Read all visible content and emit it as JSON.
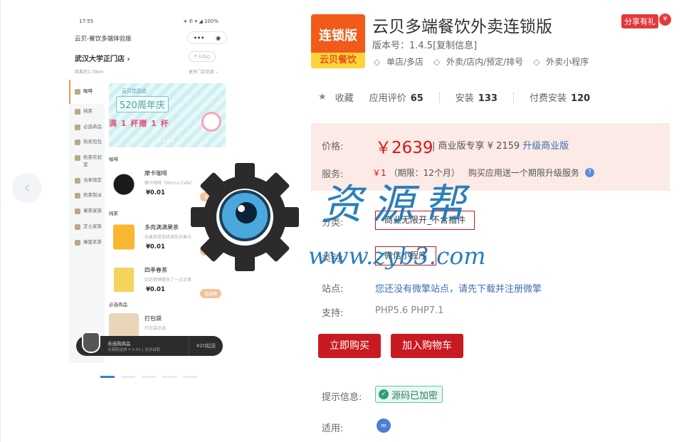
{
  "gallery": {
    "prev_icon": "chevron-left-icon",
    "phone": {
      "time": "17:55",
      "signal": "∗ ✆ ▾ ◢ 100%",
      "title": "云贝-餐饮多端体验版",
      "capsule_more": "•••",
      "capsule_close": "◉",
      "store": "武汉大学正门店 ›",
      "center": "个人中心",
      "distance": "距离您1.79km",
      "more_stores": "更多门店信息 ⌄",
      "side_items": [
        "咖啡",
        "纯茶",
        "必选商品",
        "热卖包包",
        "奶茶实验室",
        "当季限定",
        "奶茶制冰",
        "果茶家族",
        "芝士家族",
        "蜂蜜茗茶"
      ],
      "banner_top": "云贝饮品店",
      "banner_main": "520周年庆",
      "banner_sub": "满 1 杯赠 1 杯",
      "categories": [
        "咖啡",
        "纯茶",
        "必选商品"
      ],
      "items": [
        {
          "name": "摩卡咖啡",
          "desc": "摩卡咖啡（Mocca Cafe）",
          "price": "¥0.01",
          "pick": "选规格"
        },
        {
          "name": "多肉满满果茶",
          "desc": "水果茶是指将某些水果与",
          "price": "¥0.01",
          "pick": "选规格"
        },
        {
          "name": "四季春茶",
          "desc": "比奶茶稍微多了一点点茶",
          "price": "¥0.01",
          "pick": "选规格"
        },
        {
          "name": "打包袋",
          "desc": "打包袋必选",
          "price": "",
          "pick": ""
        }
      ],
      "cart_t1": "未选购商品",
      "cart_t2": "另需配送费 ¥ 0.01 | 支持自取",
      "cart_right": "¥20起送"
    }
  },
  "watermark": {
    "text": "资源帮",
    "url": "www.zyb3.com"
  },
  "app": {
    "logo_top": "连锁版",
    "logo_bottom": "云贝餐饮",
    "name": "云贝多端餐饮外卖连锁版",
    "share": "分享有礼",
    "share_icon": "¥",
    "version": "版本号：1.4.5[复制信息]",
    "tags": [
      "单店/多店",
      "外卖/店内/预定/排号",
      "外卖小程序"
    ],
    "favorite": "收藏",
    "stats": [
      {
        "label": "应用评价",
        "value": "65"
      },
      {
        "label": "安装",
        "value": "133"
      },
      {
        "label": "付费安装",
        "value": "120"
      }
    ]
  },
  "pricing": {
    "price_label": "价格:",
    "price": "￥2639",
    "price_rest": "| 商业版专享 ¥ 2159",
    "upgrade_link": "升级商业版",
    "service_label": "服务:",
    "service_price": "￥1",
    "service_term": "（期限：12个月）",
    "service_desc": "购买应用送一个期限升级服务",
    "service_q": "?"
  },
  "options": {
    "type_label": "分类:",
    "type_value": "商业无限开_不含插件",
    "kind_label": "类别:",
    "kind_value": "微信小程序",
    "site_label": "站点:",
    "site_value": "您还没有微擎站点，请先下载并注册微擎",
    "support_label": "支持:",
    "support_value": "PHP5.6   PHP7.1"
  },
  "actions": {
    "buy": "立即购买",
    "cart": "加入购物车"
  },
  "footer": {
    "hint_label": "提示信息:",
    "hint_value": "源码已加密",
    "apply_label": "适用:"
  },
  "colors": {
    "accent_red": "#c81a21",
    "price_red": "#d8141a",
    "link_blue": "#3b6fb6",
    "price_bg": "#fbeae5"
  }
}
